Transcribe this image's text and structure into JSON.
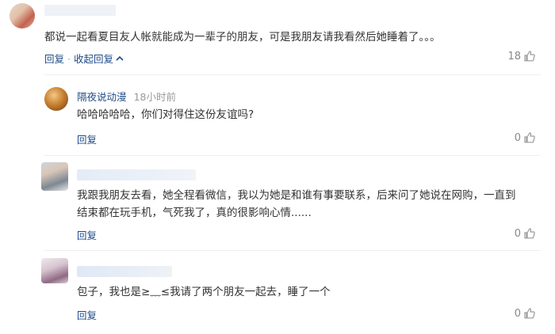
{
  "comments": [
    {
      "text": "都说一起看夏目友人帐就能成为一辈子的朋友，可是我朋友请我看然后她睡着了。。。",
      "reply_label": "回复",
      "separator": "·",
      "collapse_label": "收起回复",
      "likes": "18"
    }
  ],
  "replies": [
    {
      "username": "隔夜说动漫",
      "time": "18小时前",
      "text": "哈哈哈哈哈，你们对得住这份友谊吗?",
      "reply_label": "回复",
      "likes": "0"
    },
    {
      "text_line1": "我跟我朋友去看，她全程看微信，我以为她是和谁有事要联系，后来问了她说在网购，一直到",
      "text_line2": "结束都在玩手机，气死我了，真的很影响心情......",
      "reply_label": "回复",
      "likes": "0"
    },
    {
      "text": "包子，我也是≥﹏≤我请了两个朋友一起去，睡了一个",
      "reply_label": "回复",
      "likes": "0"
    }
  ],
  "icons": {
    "like": "thumbs-up-icon",
    "collapse": "chevron-up-icon"
  },
  "colors": {
    "link": "#1f4b87",
    "muted": "#999999",
    "text": "#333333"
  }
}
